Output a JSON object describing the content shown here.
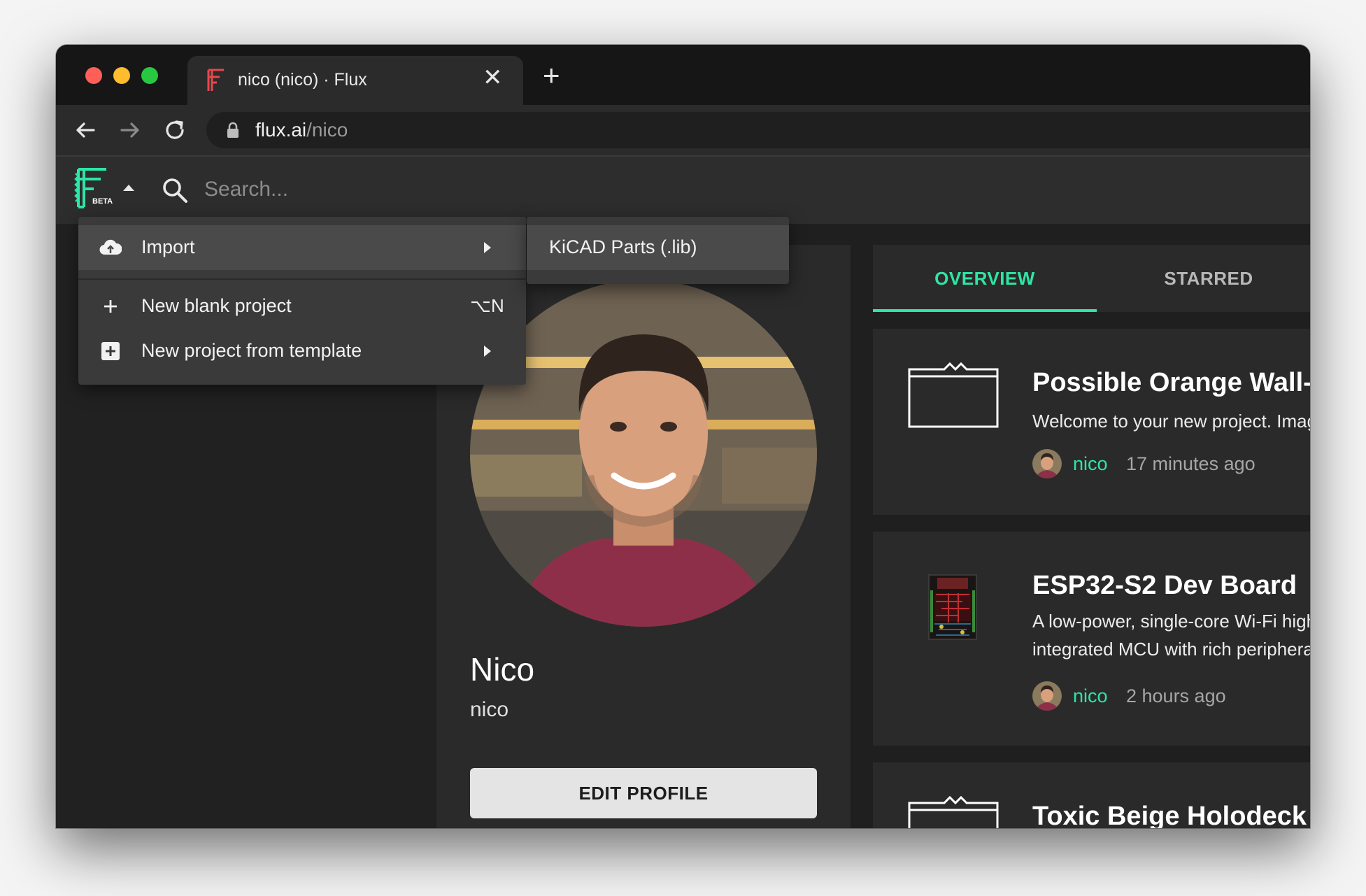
{
  "browser": {
    "tab_title": "nico (nico) · Flux",
    "tab_close": "✕",
    "new_tab": "+",
    "url_domain": "flux.ai",
    "url_path": "/nico"
  },
  "app": {
    "beta_label": "BETA",
    "search_placeholder": "Search..."
  },
  "menu": {
    "items": [
      {
        "label": "Import",
        "icon": "cloud-upload-icon",
        "has_submenu": true
      },
      {
        "label": "New blank project",
        "icon": "plus-icon",
        "shortcut": "⌥N"
      },
      {
        "label": "New project from template",
        "icon": "plus-box-icon",
        "has_submenu": true
      }
    ],
    "submenu": {
      "items": [
        {
          "label": "KiCAD Parts (.lib)"
        }
      ]
    }
  },
  "profile": {
    "name": "Nico",
    "username": "nico",
    "edit_label": "EDIT PROFILE"
  },
  "tabs": [
    {
      "label": "OVERVIEW",
      "active": true
    },
    {
      "label": "STARRED",
      "active": false
    }
  ],
  "projects": [
    {
      "title": "Possible Orange Wall-E",
      "description": "Welcome to your new project. Imagine what you can build here.",
      "author": "nico",
      "time": "17 minutes ago",
      "thumb": "folder-icon"
    },
    {
      "title": "ESP32-S2 Dev Board",
      "description": "A low-power, single-core Wi-Fi highly integrated MCU with rich peripheral capabilities.",
      "author": "nico",
      "time": "2 hours ago",
      "thumb": "pcb-thumbnail"
    },
    {
      "title": "Toxic Beige Holodeck",
      "thumb": "folder-icon"
    }
  ],
  "colors": {
    "accent": "#2ee6a6",
    "tab_icon_red": "#e5484d",
    "traffic_red": "#ff5f57",
    "traffic_yellow": "#febc2e",
    "traffic_green": "#28c840"
  }
}
